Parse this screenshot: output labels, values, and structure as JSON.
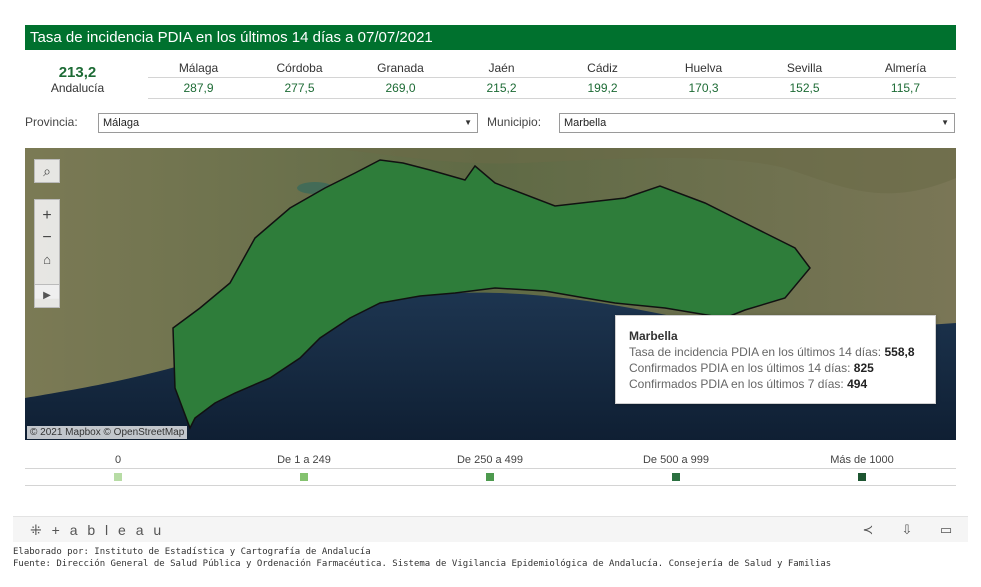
{
  "title": "Tasa de incidencia PDIA en los últimos 14 días a 07/07/2021",
  "summary": {
    "value": "213,2",
    "label": "Andalucía"
  },
  "provinces": [
    {
      "name": "Málaga",
      "value": "287,9"
    },
    {
      "name": "Córdoba",
      "value": "277,5"
    },
    {
      "name": "Granada",
      "value": "269,0"
    },
    {
      "name": "Jaén",
      "value": "215,2"
    },
    {
      "name": "Cádiz",
      "value": "199,2"
    },
    {
      "name": "Huelva",
      "value": "170,3"
    },
    {
      "name": "Sevilla",
      "value": "152,5"
    },
    {
      "name": "Almería",
      "value": "115,7"
    }
  ],
  "filters": {
    "provincia_label": "Provincia:",
    "provincia_value": "Málaga",
    "municipio_label": "Municipio:",
    "municipio_value": "Marbella"
  },
  "map": {
    "attribution": "© 2021 Mapbox  © OpenStreetMap",
    "tools": [
      "search-icon",
      "zoom-in-icon",
      "zoom-out-icon",
      "home-icon",
      "play-icon"
    ]
  },
  "tooltip": {
    "title": "Marbella",
    "line1_label": "Tasa de incidencia PDIA en los últimos 14 días:",
    "line1_value": "558,8",
    "line2_label": "Confirmados PDIA en los últimos 14 días:",
    "line2_value": "825",
    "line3_label": "Confirmados PDIA en los últimos 7 días:",
    "line3_value": "494"
  },
  "legend": [
    {
      "label": "0",
      "color": "#b7dca5"
    },
    {
      "label": "De 1 a 249",
      "color": "#84c26f"
    },
    {
      "label": "De 250 a 499",
      "color": "#4d9a4e"
    },
    {
      "label": "De 500 a 999",
      "color": "#2b7040"
    },
    {
      "label": "Más de 1000",
      "color": "#1d5531"
    }
  ],
  "colors": {
    "brand": "#00712e",
    "region_fill": "#2e7d3a"
  },
  "toolbar": {
    "logo": "+ a b l e a u",
    "icons": [
      "share-icon",
      "download-icon",
      "fullscreen-icon"
    ]
  },
  "footer": {
    "line1": "Elaborado por: Instituto de Estadística y Cartografía de Andalucía",
    "line2": "Fuente: Dirección General de Salud Pública y Ordenación Farmacéutica. Sistema de Vigilancia Epidemiológica de Andalucía. Consejería de Salud y Familias"
  }
}
